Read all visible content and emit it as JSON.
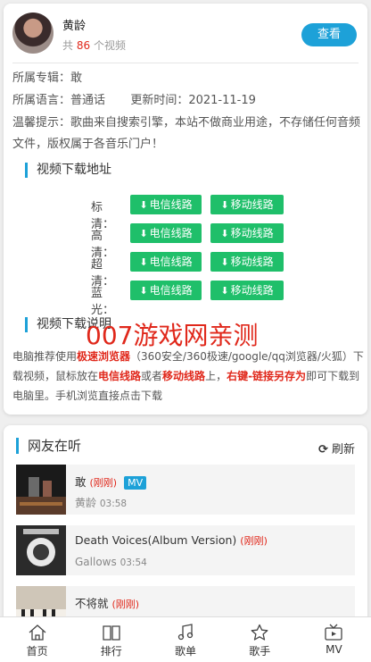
{
  "artist": {
    "name": "黄龄",
    "count_prefix": "共",
    "count": "86",
    "count_suffix": "个视频",
    "view_button": "查看"
  },
  "info": {
    "album_label": "所属专辑：",
    "album": "敢",
    "language_label": "所属语言：",
    "language": "普通话",
    "updated_label": "更新时间：",
    "updated": "2021-11-19",
    "notice": "温馨提示：歌曲来自搜索引擎，本站不做商业用途，不存储任何音频文件，版权属于各音乐门户！"
  },
  "download": {
    "title": "视频下载地址",
    "rows": [
      {
        "label": "标清：",
        "btn1": "电信线路",
        "btn2": "移动线路"
      },
      {
        "label": "高清：",
        "btn1": "电信线路",
        "btn2": "移动线路"
      },
      {
        "label": "超清：",
        "btn1": "电信线路",
        "btn2": "移动线路"
      },
      {
        "label": "蓝光：",
        "btn1": "电信线路",
        "btn2": "移动线路"
      }
    ],
    "btn_color": "#1fbf6a"
  },
  "instructions": {
    "title": "视频下载说明",
    "t1": "电脑推荐使用",
    "r1": "极速浏览器",
    "t2": "（360安全/360极速/google/qq浏览器/火狐）下载视频，鼠标放在",
    "r2": "电信线路",
    "t3": "或者",
    "r3": "移动线路",
    "t4": "上，",
    "r4": "右键-链接另存为",
    "t5": "即可下载到电脑里。手机浏览直接点击下载"
  },
  "watermark": "007游戏网亲测",
  "listening": {
    "title": "网友在听",
    "refresh": "刷新",
    "songs": [
      {
        "title": "敢",
        "tag": "(刚刚)",
        "mv": "MV",
        "artist": "黄龄",
        "duration": "03:58"
      },
      {
        "title": "Death Voices(Album Version)",
        "tag": "(刚刚)",
        "artist": "Gallows",
        "duration": "03:54"
      },
      {
        "title": "不将就",
        "tag": "(刚刚)"
      }
    ]
  },
  "tabbar": {
    "items": [
      {
        "label": "首页",
        "icon": "home-icon"
      },
      {
        "label": "排行",
        "icon": "book-icon"
      },
      {
        "label": "歌单",
        "icon": "music-note-icon"
      },
      {
        "label": "歌手",
        "icon": "star-icon"
      },
      {
        "label": "MV",
        "icon": "tv-icon"
      }
    ]
  },
  "colors": {
    "accent": "#1da1d8",
    "red": "#e0281b",
    "green": "#1fbf6a"
  }
}
